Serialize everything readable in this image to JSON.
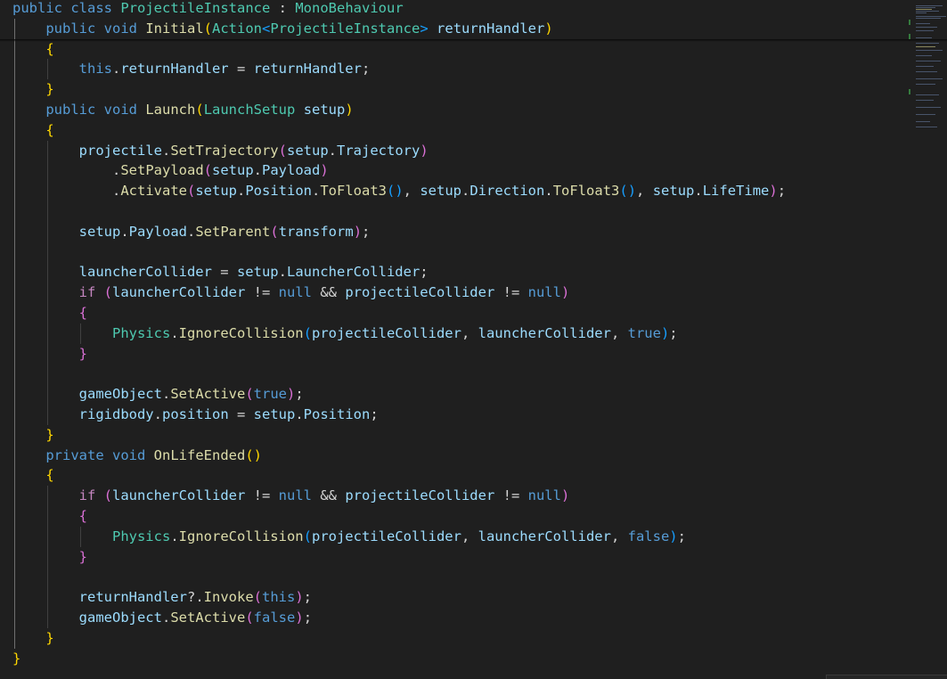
{
  "editor": {
    "lines": [
      [
        [
          "kw",
          "public"
        ],
        [
          "op",
          " "
        ],
        [
          "kw",
          "class"
        ],
        [
          "op",
          " "
        ],
        [
          "ty",
          "ProjectileInstance"
        ],
        [
          "op",
          " : "
        ],
        [
          "ty",
          "MonoBehaviour"
        ]
      ],
      [
        [
          "op",
          "    "
        ],
        [
          "kw",
          "public"
        ],
        [
          "op",
          " "
        ],
        [
          "kw",
          "void"
        ],
        [
          "op",
          " "
        ],
        [
          "fn",
          "Initial"
        ],
        [
          "p1",
          "("
        ],
        [
          "ty",
          "Action"
        ],
        [
          "p3",
          "<"
        ],
        [
          "ty",
          "ProjectileInstance"
        ],
        [
          "p3",
          ">"
        ],
        [
          "op",
          " "
        ],
        [
          "var",
          "returnHandler"
        ],
        [
          "p1",
          ")"
        ]
      ],
      [
        [
          "op",
          "    "
        ],
        [
          "p1",
          "{"
        ]
      ],
      [
        [
          "op",
          "        "
        ],
        [
          "kw",
          "this"
        ],
        [
          "op",
          "."
        ],
        [
          "var",
          "returnHandler"
        ],
        [
          "op",
          " = "
        ],
        [
          "var",
          "returnHandler"
        ],
        [
          "op",
          ";"
        ]
      ],
      [
        [
          "op",
          "    "
        ],
        [
          "p1",
          "}"
        ]
      ],
      [
        [
          "op",
          "    "
        ],
        [
          "kw",
          "public"
        ],
        [
          "op",
          " "
        ],
        [
          "kw",
          "void"
        ],
        [
          "op",
          " "
        ],
        [
          "fn",
          "Launch"
        ],
        [
          "p1",
          "("
        ],
        [
          "ty",
          "LaunchSetup"
        ],
        [
          "op",
          " "
        ],
        [
          "var",
          "setup"
        ],
        [
          "p1",
          ")"
        ]
      ],
      [
        [
          "op",
          "    "
        ],
        [
          "p1",
          "{"
        ]
      ],
      [
        [
          "op",
          "        "
        ],
        [
          "var",
          "projectile"
        ],
        [
          "op",
          "."
        ],
        [
          "fn",
          "SetTrajectory"
        ],
        [
          "p2",
          "("
        ],
        [
          "var",
          "setup"
        ],
        [
          "op",
          "."
        ],
        [
          "var",
          "Trajectory"
        ],
        [
          "p2",
          ")"
        ]
      ],
      [
        [
          "op",
          "            ."
        ],
        [
          "fn",
          "SetPayload"
        ],
        [
          "p2",
          "("
        ],
        [
          "var",
          "setup"
        ],
        [
          "op",
          "."
        ],
        [
          "var",
          "Payload"
        ],
        [
          "p2",
          ")"
        ]
      ],
      [
        [
          "op",
          "            ."
        ],
        [
          "fn",
          "Activate"
        ],
        [
          "p2",
          "("
        ],
        [
          "var",
          "setup"
        ],
        [
          "op",
          "."
        ],
        [
          "var",
          "Position"
        ],
        [
          "op",
          "."
        ],
        [
          "fn",
          "ToFloat3"
        ],
        [
          "p3",
          "()"
        ],
        [
          "op",
          ", "
        ],
        [
          "var",
          "setup"
        ],
        [
          "op",
          "."
        ],
        [
          "var",
          "Direction"
        ],
        [
          "op",
          "."
        ],
        [
          "fn",
          "ToFloat3"
        ],
        [
          "p3",
          "()"
        ],
        [
          "op",
          ", "
        ],
        [
          "var",
          "setup"
        ],
        [
          "op",
          "."
        ],
        [
          "var",
          "LifeTime"
        ],
        [
          "p2",
          ")"
        ],
        [
          "op",
          ";"
        ]
      ],
      [],
      [
        [
          "op",
          "        "
        ],
        [
          "var",
          "setup"
        ],
        [
          "op",
          "."
        ],
        [
          "var",
          "Payload"
        ],
        [
          "op",
          "."
        ],
        [
          "fn",
          "SetParent"
        ],
        [
          "p2",
          "("
        ],
        [
          "var",
          "transform"
        ],
        [
          "p2",
          ")"
        ],
        [
          "op",
          ";"
        ]
      ],
      [],
      [
        [
          "op",
          "        "
        ],
        [
          "var",
          "launcherCollider"
        ],
        [
          "op",
          " = "
        ],
        [
          "var",
          "setup"
        ],
        [
          "op",
          "."
        ],
        [
          "var",
          "LauncherCollider"
        ],
        [
          "op",
          ";"
        ]
      ],
      [
        [
          "op",
          "        "
        ],
        [
          "ctrl",
          "if"
        ],
        [
          "op",
          " "
        ],
        [
          "p2",
          "("
        ],
        [
          "var",
          "launcherCollider"
        ],
        [
          "op",
          " != "
        ],
        [
          "kw",
          "null"
        ],
        [
          "op",
          " && "
        ],
        [
          "var",
          "projectileCollider"
        ],
        [
          "op",
          " != "
        ],
        [
          "kw",
          "null"
        ],
        [
          "p2",
          ")"
        ]
      ],
      [
        [
          "op",
          "        "
        ],
        [
          "p2",
          "{"
        ]
      ],
      [
        [
          "op",
          "            "
        ],
        [
          "ty",
          "Physics"
        ],
        [
          "op",
          "."
        ],
        [
          "fn",
          "IgnoreCollision"
        ],
        [
          "p3",
          "("
        ],
        [
          "var",
          "projectileCollider"
        ],
        [
          "op",
          ", "
        ],
        [
          "var",
          "launcherCollider"
        ],
        [
          "op",
          ", "
        ],
        [
          "kw",
          "true"
        ],
        [
          "p3",
          ")"
        ],
        [
          "op",
          ";"
        ]
      ],
      [
        [
          "op",
          "        "
        ],
        [
          "p2",
          "}"
        ]
      ],
      [],
      [
        [
          "op",
          "        "
        ],
        [
          "var",
          "gameObject"
        ],
        [
          "op",
          "."
        ],
        [
          "fn",
          "SetActive"
        ],
        [
          "p2",
          "("
        ],
        [
          "kw",
          "true"
        ],
        [
          "p2",
          ")"
        ],
        [
          "op",
          ";"
        ]
      ],
      [
        [
          "op",
          "        "
        ],
        [
          "var",
          "rigidbody"
        ],
        [
          "op",
          "."
        ],
        [
          "var",
          "position"
        ],
        [
          "op",
          " = "
        ],
        [
          "var",
          "setup"
        ],
        [
          "op",
          "."
        ],
        [
          "var",
          "Position"
        ],
        [
          "op",
          ";"
        ]
      ],
      [
        [
          "op",
          "    "
        ],
        [
          "p1",
          "}"
        ]
      ],
      [
        [
          "op",
          "    "
        ],
        [
          "kw",
          "private"
        ],
        [
          "op",
          " "
        ],
        [
          "kw",
          "void"
        ],
        [
          "op",
          " "
        ],
        [
          "fn",
          "OnLifeEnded"
        ],
        [
          "p1",
          "()"
        ]
      ],
      [
        [
          "op",
          "    "
        ],
        [
          "p1",
          "{"
        ]
      ],
      [
        [
          "op",
          "        "
        ],
        [
          "ctrl",
          "if"
        ],
        [
          "op",
          " "
        ],
        [
          "p2",
          "("
        ],
        [
          "var",
          "launcherCollider"
        ],
        [
          "op",
          " != "
        ],
        [
          "kw",
          "null"
        ],
        [
          "op",
          " && "
        ],
        [
          "var",
          "projectileCollider"
        ],
        [
          "op",
          " != "
        ],
        [
          "kw",
          "null"
        ],
        [
          "p2",
          ")"
        ]
      ],
      [
        [
          "op",
          "        "
        ],
        [
          "p2",
          "{"
        ]
      ],
      [
        [
          "op",
          "            "
        ],
        [
          "ty",
          "Physics"
        ],
        [
          "op",
          "."
        ],
        [
          "fn",
          "IgnoreCollision"
        ],
        [
          "p3",
          "("
        ],
        [
          "var",
          "projectileCollider"
        ],
        [
          "op",
          ", "
        ],
        [
          "var",
          "launcherCollider"
        ],
        [
          "op",
          ", "
        ],
        [
          "kw",
          "false"
        ],
        [
          "p3",
          ")"
        ],
        [
          "op",
          ";"
        ]
      ],
      [
        [
          "op",
          "        "
        ],
        [
          "p2",
          "}"
        ]
      ],
      [],
      [
        [
          "op",
          "        "
        ],
        [
          "var",
          "returnHandler"
        ],
        [
          "op",
          "?."
        ],
        [
          "fn",
          "Invoke"
        ],
        [
          "p2",
          "("
        ],
        [
          "kw",
          "this"
        ],
        [
          "p2",
          ")"
        ],
        [
          "op",
          ";"
        ]
      ],
      [
        [
          "op",
          "        "
        ],
        [
          "var",
          "gameObject"
        ],
        [
          "op",
          "."
        ],
        [
          "fn",
          "SetActive"
        ],
        [
          "p2",
          "("
        ],
        [
          "kw",
          "false"
        ],
        [
          "p2",
          ")"
        ],
        [
          "op",
          ";"
        ]
      ],
      [
        [
          "op",
          "    "
        ],
        [
          "p1",
          "}"
        ]
      ],
      [
        [
          "p1",
          "}"
        ]
      ]
    ]
  },
  "theme": {
    "background": "#1f1f1f",
    "keyword": "#569cd6",
    "type": "#4ec9b0",
    "function": "#dcdcaa",
    "variable": "#9cdcfe",
    "bracket_gold": "#ffd700",
    "bracket_orchid": "#da70d6",
    "bracket_blue": "#179fff"
  }
}
